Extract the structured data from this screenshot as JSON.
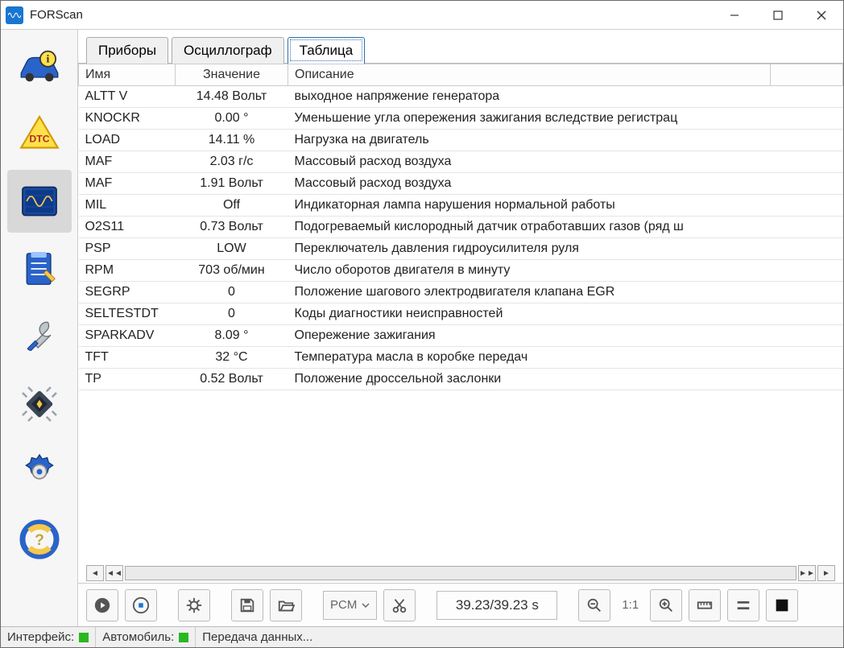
{
  "app": {
    "title": "FORScan"
  },
  "tabs": [
    {
      "label": "Приборы",
      "active": false
    },
    {
      "label": "Осциллограф",
      "active": false
    },
    {
      "label": "Таблица",
      "active": true
    }
  ],
  "columns": {
    "name": "Имя",
    "value": "Значение",
    "desc": "Описание"
  },
  "rows": [
    {
      "name": "ALTT V",
      "value": "14.48 Вольт",
      "desc": "выходное напряжение генератора"
    },
    {
      "name": "KNOCKR",
      "value": "0.00 °",
      "desc": "Уменьшение угла опережения зажигания вследствие регистрац"
    },
    {
      "name": "LOAD",
      "value": "14.11 %",
      "desc": "Нагрузка на двигатель"
    },
    {
      "name": "MAF",
      "value": "2.03 г/с",
      "desc": "Массовый расход воздуха"
    },
    {
      "name": "MAF",
      "value": "1.91 Вольт",
      "desc": "Массовый расход воздуха"
    },
    {
      "name": "MIL",
      "value": "Off",
      "desc": "Индикаторная лампа нарушения нормальной работы"
    },
    {
      "name": "O2S11",
      "value": "0.73 Вольт",
      "desc": "Подогреваемый кислородный датчик отработавших газов (ряд ш"
    },
    {
      "name": "PSP",
      "value": "LOW",
      "desc": "Переключатель давления гидроусилителя руля"
    },
    {
      "name": "RPM",
      "value": "703 об/мин",
      "desc": "Число оборотов двигателя в минуту"
    },
    {
      "name": "SEGRP",
      "value": "0",
      "desc": "Положение шагового электродвигателя клапана EGR"
    },
    {
      "name": "SELTESTDT",
      "value": "0",
      "desc": "Коды диагностики неисправностей"
    },
    {
      "name": "SPARKADV",
      "value": "8.09 °",
      "desc": "Опережение зажигания"
    },
    {
      "name": "TFT",
      "value": "32 °C",
      "desc": "Температура масла в коробке передач"
    },
    {
      "name": "TP",
      "value": "0.52 Вольт",
      "desc": "Положение дроссельной заслонки"
    }
  ],
  "bottom": {
    "module": "PCM",
    "time": "39.23/39.23 s",
    "zoom": "1:1"
  },
  "status": {
    "iface_label": "Интерфейс:",
    "auto_label": "Автомобиль:",
    "activity": "Передача данных..."
  }
}
